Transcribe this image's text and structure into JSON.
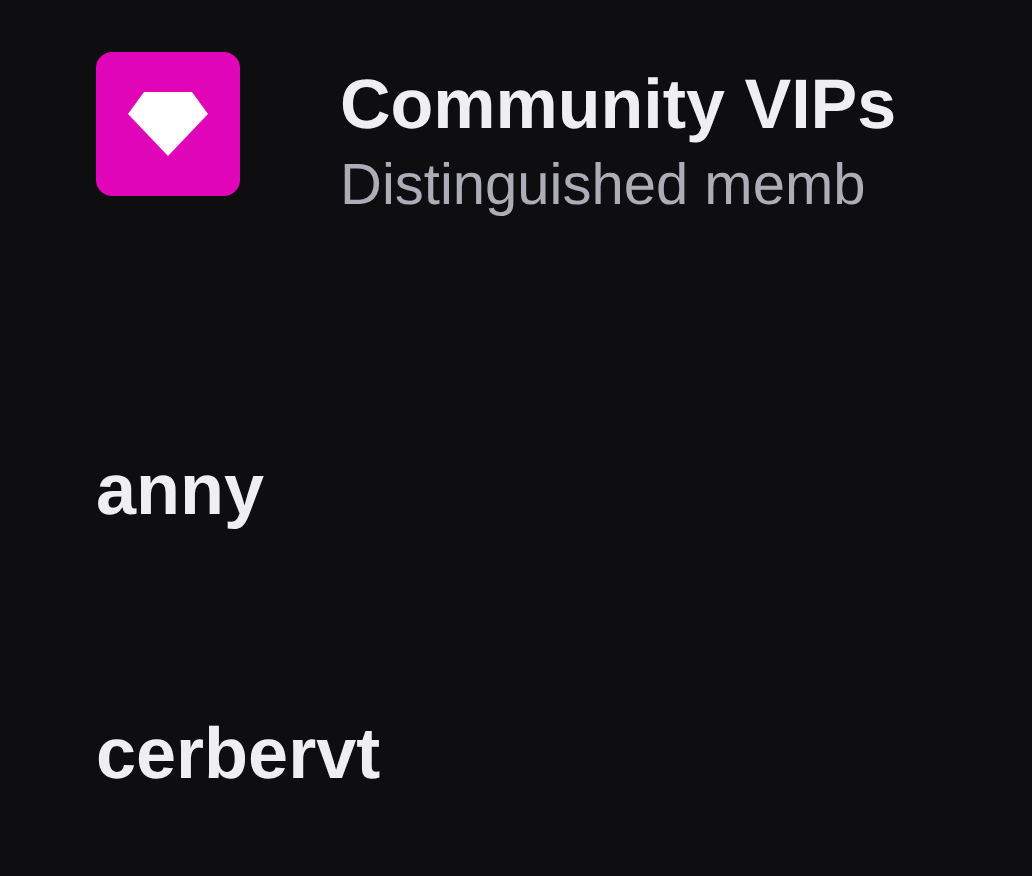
{
  "header": {
    "title": "Community VIPs",
    "subtitle": "Distinguished memb"
  },
  "members": [
    {
      "name": "anny"
    },
    {
      "name": "cerbervt"
    }
  ]
}
